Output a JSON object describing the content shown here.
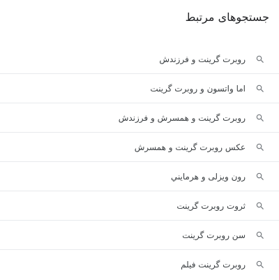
{
  "related_searches": {
    "title": "جستجوهای مرتبط",
    "icon": "search-icon",
    "icon_color": "#70757a",
    "divider_color": "#e8eaed",
    "items": [
      {
        "label": "روبرت گرینت و فرزندش"
      },
      {
        "label": "اما واتسون و روبرت گرینت"
      },
      {
        "label": "روبرت گرینت و همسرش و فرزندش"
      },
      {
        "label": "عکس روبرت گرینت و همسرش"
      },
      {
        "label": "رون ویزلی و هرمایني"
      },
      {
        "label": "ثروت روبرت گرینت"
      },
      {
        "label": "سن روبرت گرینت"
      },
      {
        "label": "روبرت گرینت فیلم"
      }
    ]
  }
}
